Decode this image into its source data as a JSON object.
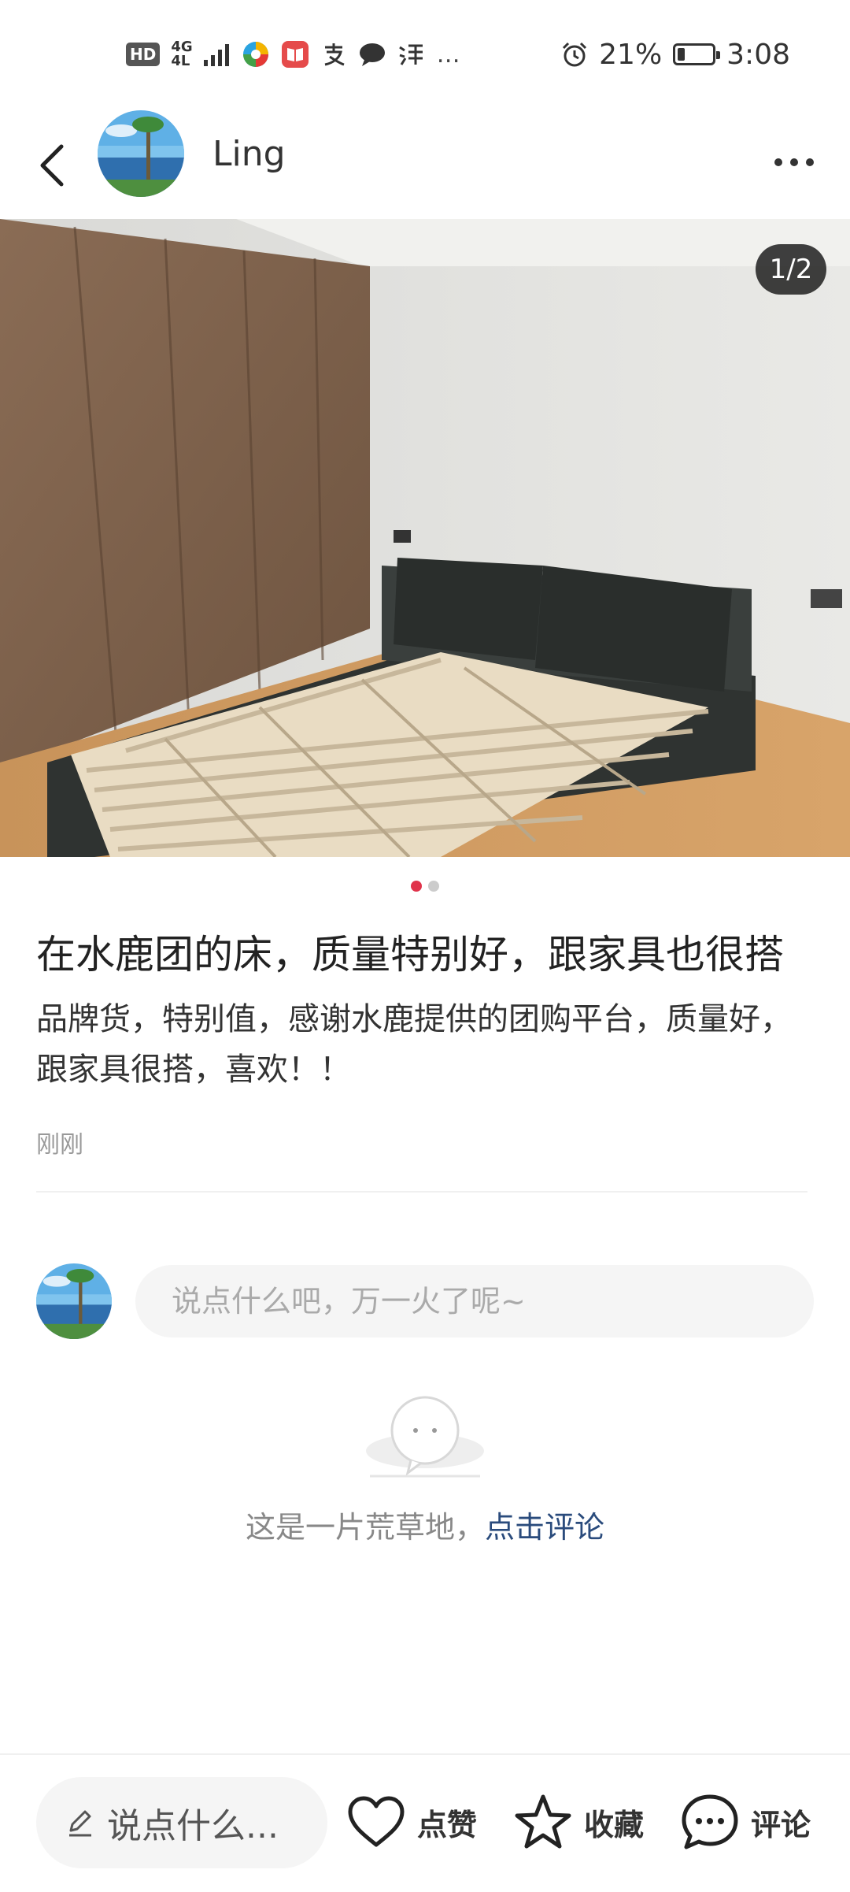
{
  "status_bar": {
    "hd_badge": "HD",
    "network_top": "4G",
    "network_bottom": "4L",
    "more_glyph": "…",
    "battery_percent": "21%",
    "battery_level": 0.21,
    "time": "3:08"
  },
  "header": {
    "author_name": "Ling"
  },
  "photo": {
    "counter": "1/2",
    "current_index": 1,
    "total": 2
  },
  "post": {
    "title": "在水鹿团的床，质量特别好，跟家具也很搭",
    "body": "品牌货，特别值，感谢水鹿提供的团购平台，质量好，跟家具很搭，喜欢！！",
    "time": "刚刚"
  },
  "comment": {
    "placeholder": "说点什么吧，万一火了呢~"
  },
  "empty_state": {
    "text": "这是一片荒草地，",
    "link": "点击评论"
  },
  "bottom_bar": {
    "input_label": "说点什么...",
    "like_label": "点赞",
    "collect_label": "收藏",
    "comment_label": "评论"
  },
  "colors": {
    "accent": "#e0334b",
    "link": "#2a4b7c"
  }
}
